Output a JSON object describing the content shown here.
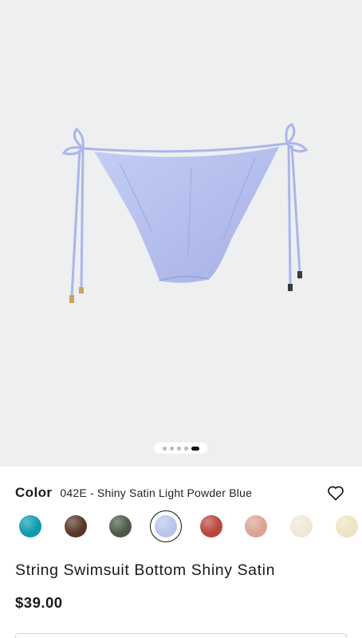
{
  "product": {
    "name": "String Swimsuit Bottom Shiny Satin",
    "price": "$39.00",
    "image_count": 5,
    "active_image": 5
  },
  "color": {
    "title": "Color",
    "selected_value": "042E - Shiny Satin Light Powder Blue",
    "swatches": [
      {
        "name": "teal",
        "color": "#0f9ab0"
      },
      {
        "name": "brown",
        "color": "#5a3626"
      },
      {
        "name": "olive",
        "color": "#4c5b45"
      },
      {
        "name": "light-powder-blue",
        "color": "#b9c5ec",
        "selected": true
      },
      {
        "name": "red",
        "color": "#b9453e"
      },
      {
        "name": "pink",
        "color": "#dca394"
      },
      {
        "name": "cream",
        "color": "#efe8d6"
      },
      {
        "name": "ivory",
        "color": "#ece4c2"
      }
    ]
  },
  "icons": {
    "wishlist": "heart-outline-icon"
  },
  "colors": {
    "hero_background": "#eeeff1",
    "product_fabric": "#b8c3ef",
    "text": "#1a1a1a"
  }
}
